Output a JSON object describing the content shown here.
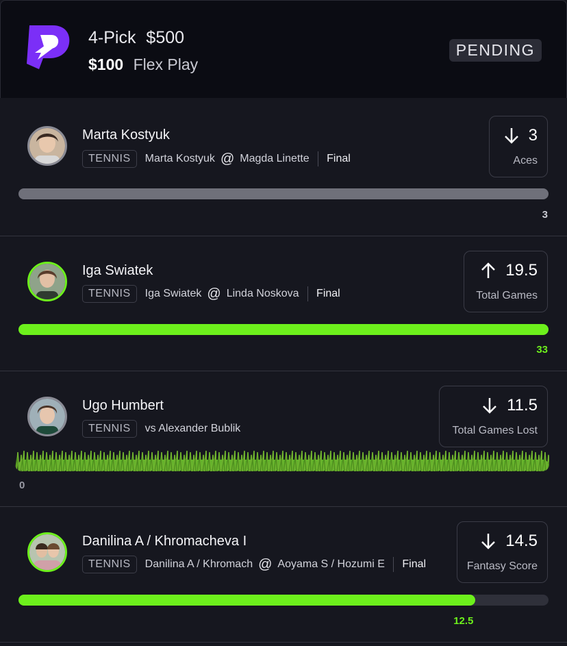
{
  "header": {
    "picks": "4-Pick",
    "payout": "$500",
    "entry": "$100",
    "play_type": "Flex Play",
    "status": "PENDING"
  },
  "picks": [
    {
      "player": "Marta Kostyuk",
      "sport": "TENNIS",
      "team": "Marta Kostyuk",
      "connector": "@",
      "opponent": "Magda Linette",
      "game_status": "Final",
      "direction": "down",
      "line": "3",
      "stat": "Aces",
      "result": "3",
      "progress": 1.0,
      "bar_color": "#6f707a",
      "result_color": "#c9cad2",
      "avatar_icon": "player-photo-icon"
    },
    {
      "player": "Iga Swiatek",
      "sport": "TENNIS",
      "team": "Iga Swiatek",
      "connector": "@",
      "opponent": "Linda Noskova",
      "game_status": "Final",
      "direction": "up",
      "line": "19.5",
      "stat": "Total Games",
      "result": "33",
      "progress": 1.0,
      "bar_color": "#6df01c",
      "result_color": "#6df01c",
      "avatar_icon": "player-photo-icon"
    },
    {
      "player": "Ugo Humbert",
      "sport": "TENNIS",
      "matchup": "vs Alexander Bublik",
      "direction": "down",
      "line": "11.5",
      "stat": "Total Games Lost",
      "result": "0",
      "progress": 1.0,
      "bar_color": "#5fb52a",
      "result_color": "#9a9ba5",
      "avatar_icon": "player-photo-icon"
    },
    {
      "player": "Danilina A / Khromacheva I",
      "sport": "TENNIS",
      "team": "Danilina A / Khromach",
      "connector": "@",
      "opponent": "Aoyama S / Hozumi E",
      "game_status": "Final",
      "direction": "down",
      "line": "14.5",
      "stat": "Fantasy Score",
      "result": "12.5",
      "progress": 0.862,
      "bar_color": "#6df01c",
      "result_color": "#6df01c",
      "avatar_icon": "player-photo-icon"
    }
  ],
  "colors": {
    "accent_green": "#6df01c",
    "brand_purple": "#7b2ff7",
    "background": "#16171f"
  }
}
